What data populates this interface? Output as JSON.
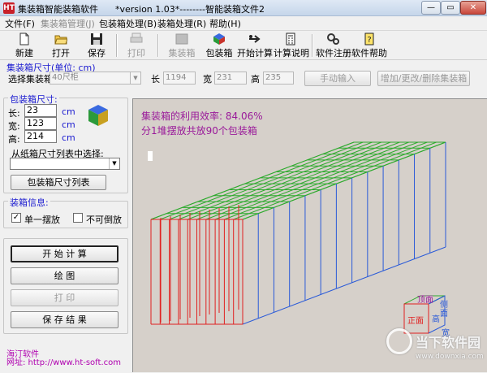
{
  "window": {
    "app_icon": "HT",
    "title": "集装箱智能装箱软件      *version 1.03*--------智能装箱文件2",
    "min": "—",
    "max": "▭",
    "close": "✕"
  },
  "menu": {
    "items": [
      "文件(F)",
      "集装箱管理(J)",
      "包装箱处理(B)",
      "装箱处理(R)",
      "帮助(H)"
    ]
  },
  "toolbar": {
    "new": "新建",
    "open": "打开",
    "save": "保存",
    "print": "打印",
    "container": "集装箱",
    "package": "包装箱",
    "start_calc": "开始计算",
    "calc_explain": "计算说明",
    "register": "软件注册",
    "help": "软件帮助"
  },
  "container": {
    "group_title": "集装箱尺寸(单位: cm)",
    "select_label": "选择集装箱",
    "selected": "40尺柜",
    "length_label": "长",
    "length": "1194",
    "width_label": "宽",
    "width": "231",
    "height_label": "高",
    "height": "235",
    "manual_input": "手动输入",
    "add_edit_delete": "增加/更改/删除集装箱"
  },
  "package": {
    "group_title": "包装箱尺寸:",
    "length_label": "长:",
    "length": "23",
    "width_label": "宽:",
    "width": "123",
    "height_label": "高:",
    "height": "214",
    "unit": "cm",
    "carton_list_label": "从纸箱尺寸列表中选择:",
    "carton_list_value": "",
    "list_button": "包装箱尺寸列表"
  },
  "packing_info": {
    "group_title": "装箱信息:",
    "single_stack": "单一摆放",
    "single_stack_checked": "✓",
    "no_side": "不可倒放",
    "no_side_checked": ""
  },
  "actions": {
    "start": "开 始 计 算",
    "draw": "绘    图",
    "print": "打    印",
    "save_result": "保 存 结 果"
  },
  "footer": {
    "company": "海汀软件",
    "url": "网址: http://www.ht-soft.com"
  },
  "canvas": {
    "utilization": "集装箱的利用效率: 84.06%",
    "count": "分1堆摆放共放90个包装箱",
    "legend_top": "顶面",
    "legend_front": "正面",
    "legend_side": "侧面",
    "legend_height": "高",
    "legend_width": "宽"
  },
  "watermark": {
    "brand": "当下软件园",
    "url": "www.downxia.com"
  },
  "colors": {
    "group_title_blue": "#1a1ad0",
    "info_purple": "#9a1a9a",
    "canvas_bg": "#d6d0ca",
    "box_green": "#2eaa2e",
    "box_blue": "#2a5ad8",
    "box_red": "#e02020"
  },
  "icons": {
    "new": "new-file-icon",
    "open": "open-folder-icon",
    "save": "floppy-disk-icon",
    "print": "printer-icon",
    "container": "container-box-icon",
    "package": "package-cube-icon",
    "start_calc": "calculate-arrow-icon",
    "calc_explain": "calculator-icon",
    "register": "gears-icon",
    "help": "help-book-icon"
  }
}
